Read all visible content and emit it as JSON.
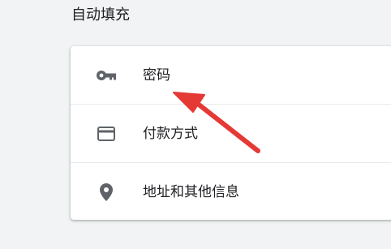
{
  "section": {
    "title": "自动填充"
  },
  "items": [
    {
      "label": "密码",
      "icon": "key-icon"
    },
    {
      "label": "付款方式",
      "icon": "credit-card-icon"
    },
    {
      "label": "地址和其他信息",
      "icon": "location-pin-icon"
    }
  ],
  "colors": {
    "icon": "#5f6368",
    "arrow": "#e53935",
    "card_background": "#ffffff",
    "page_background": "#f1f3f4"
  }
}
